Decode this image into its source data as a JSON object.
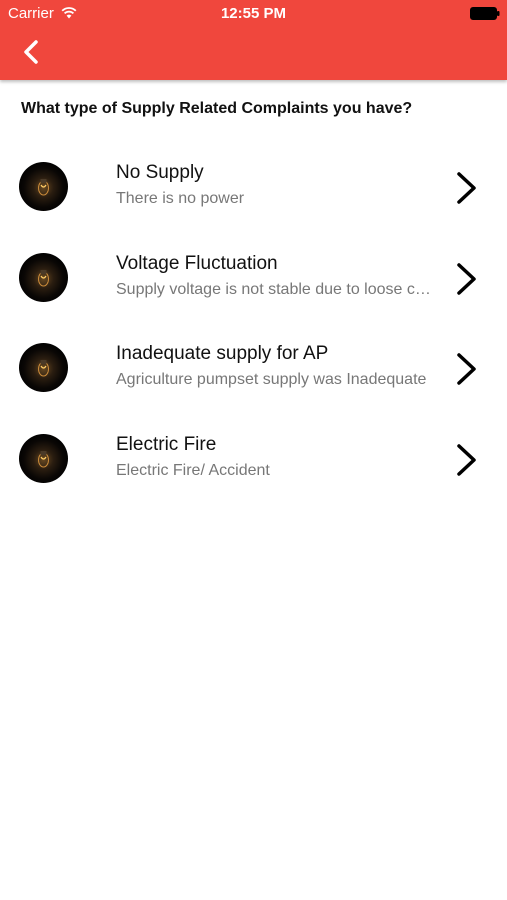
{
  "status_bar": {
    "carrier": "Carrier",
    "time": "12:55 PM"
  },
  "header": {
    "color": "#f0473d",
    "back_icon": "chevron-left-icon"
  },
  "question": "What type of Supply Related Complaints you have?",
  "complaints": [
    {
      "title": "No Supply",
      "subtitle": "There is no power"
    },
    {
      "title": "Voltage Fluctuation",
      "subtitle": "Supply voltage is not stable due to loose connections"
    },
    {
      "title": "Inadequate supply for AP",
      "subtitle": "Agriculture pumpset supply was Inadequate"
    },
    {
      "title": "Electric Fire",
      "subtitle": "Electric Fire/ Accident"
    }
  ]
}
